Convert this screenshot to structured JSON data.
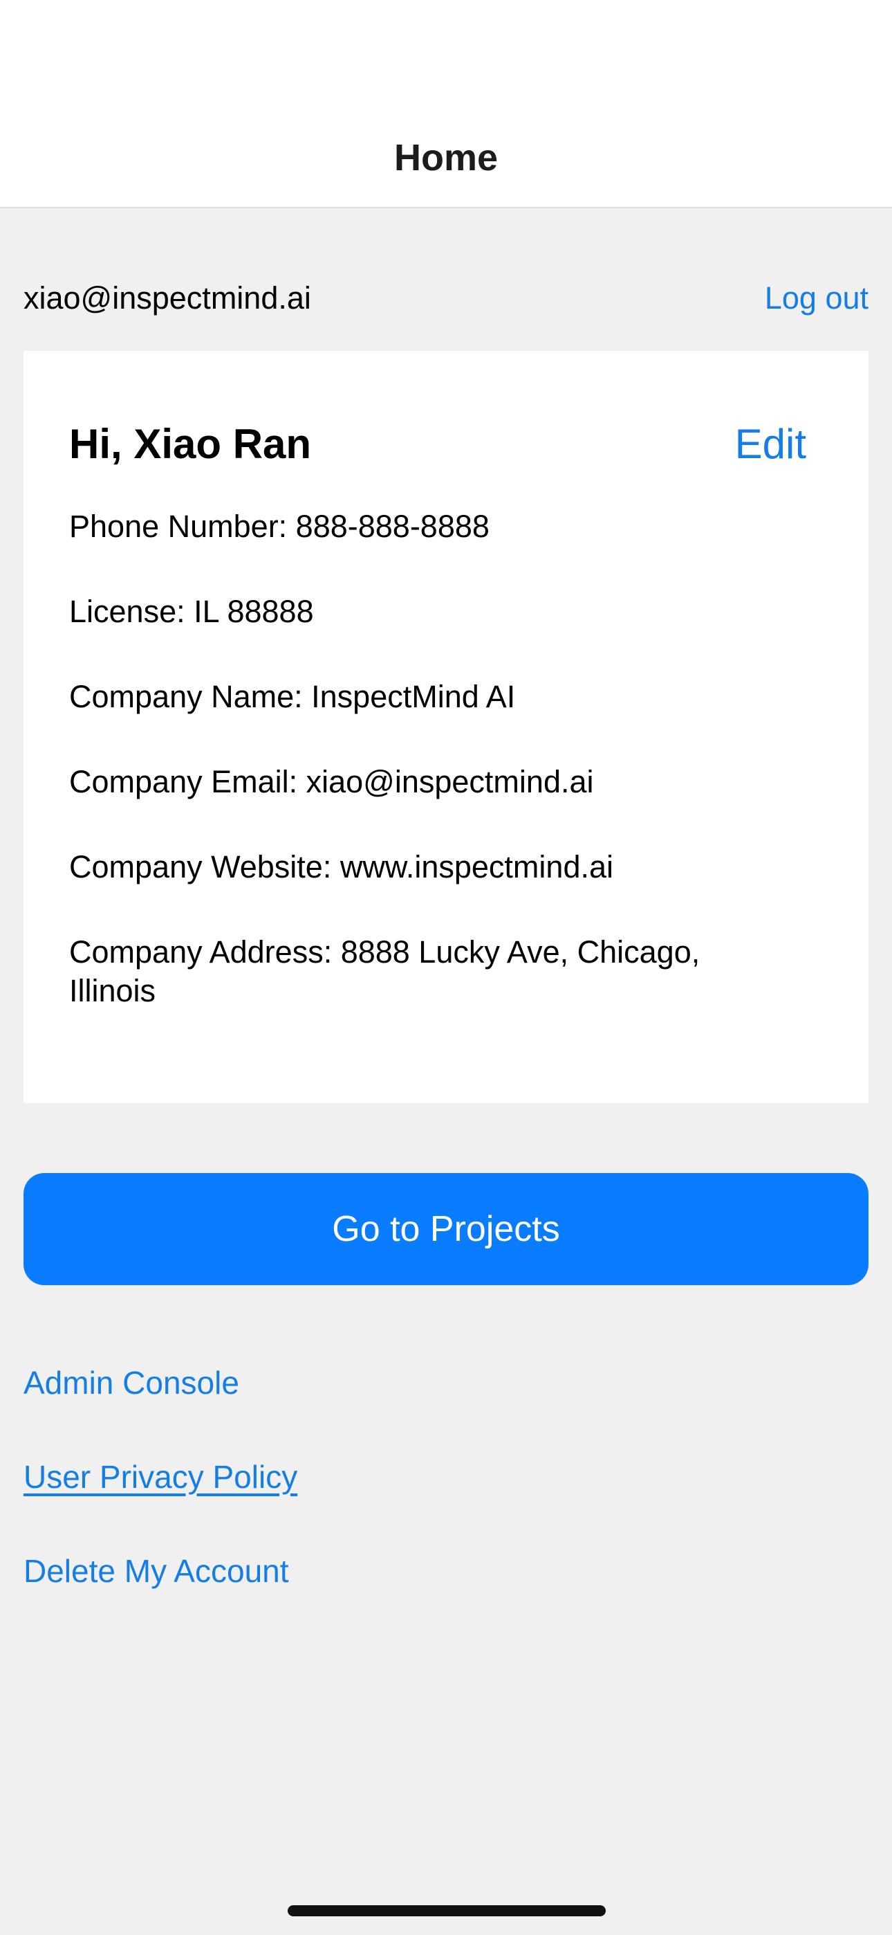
{
  "nav": {
    "title": "Home"
  },
  "account": {
    "email": "xiao@inspectmind.ai",
    "logout_label": "Log out"
  },
  "profile": {
    "greeting": "Hi, Xiao Ran",
    "edit_label": "Edit",
    "phone": "Phone Number: 888-888-8888",
    "license": "License: IL 88888",
    "company_name": "Company Name: InspectMind AI",
    "company_email": "Company Email: xiao@inspectmind.ai",
    "company_website": "Company Website: www.inspectmind.ai",
    "company_address": "Company Address: 8888 Lucky Ave, Chicago, Illinois"
  },
  "actions": {
    "projects_label": "Go to Projects"
  },
  "links": {
    "admin_console": "Admin Console",
    "privacy_policy": "User Privacy Policy",
    "delete_account": "Delete My Account"
  },
  "colors": {
    "accent": "#147ee6",
    "button": "#0a7cff",
    "background": "#f0f0f0",
    "card": "#ffffff"
  }
}
